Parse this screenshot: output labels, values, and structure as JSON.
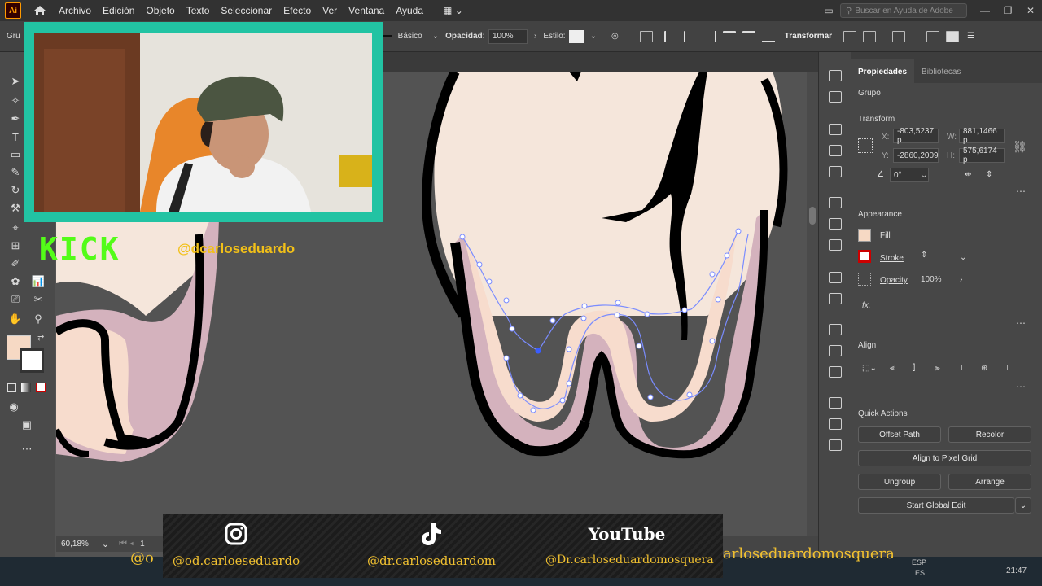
{
  "app": {
    "logo": "Ai"
  },
  "menu": [
    "Archivo",
    "Edición",
    "Objeto",
    "Texto",
    "Seleccionar",
    "Efecto",
    "Ver",
    "Ventana",
    "Ayuda"
  ],
  "search": {
    "placeholder": "Buscar en Ayuda de Adobe"
  },
  "control_bar": {
    "group_label": "Gru",
    "stroke_style": "Básico",
    "opacity_label": "Opacidad:",
    "opacity_value": "100%",
    "style_label": "Estilo:",
    "transform_label": "Transformar"
  },
  "panel": {
    "tabs": [
      "Propiedades",
      "Bibliotecas"
    ],
    "object_type": "Grupo",
    "transform": {
      "title": "Transform",
      "x_label": "X:",
      "x_value": "-803,5237 p",
      "y_label": "Y:",
      "y_value": "-2860,2009",
      "w_label": "W:",
      "w_value": "881,1466 p",
      "h_label": "H:",
      "h_value": "575,6174 p",
      "angle_value": "0°"
    },
    "appearance": {
      "title": "Appearance",
      "fill_label": "Fill",
      "stroke_label": "Stroke",
      "opacity_label": "Opacity",
      "opacity_value": "100%",
      "fx_label": "fx."
    },
    "align": {
      "title": "Align"
    },
    "quick_actions": {
      "title": "Quick Actions",
      "offset_path": "Offset Path",
      "recolor": "Recolor",
      "align_pixel": "Align to Pixel Grid",
      "ungroup": "Ungroup",
      "arrange": "Arrange",
      "global_edit": "Start Global Edit"
    }
  },
  "status": {
    "zoom": "60,18%",
    "artboard": "1"
  },
  "overlay": {
    "kick_logo": "KICK",
    "kick_handle": "@dcarloseduardo",
    "instagram": "@od.carloeseduardo",
    "tiktok": "@dr.carloseduardom",
    "youtube_logo": "YouTube",
    "youtube": "@Dr.carloseduardomosquera",
    "overflow_right": "arloseduardomosquera",
    "overflow_left": "@o"
  },
  "taskbar": {
    "lang": "ESP",
    "region": "ES",
    "time": "21:47"
  },
  "colors": {
    "fill_swatch": "#f6d9c4",
    "accent": "#22c3a3",
    "kick_green": "#53fc18",
    "gold": "#f0c030",
    "tooth": "#f5e6db",
    "gum": "#d4b2bd",
    "path": "#7a8cff"
  }
}
